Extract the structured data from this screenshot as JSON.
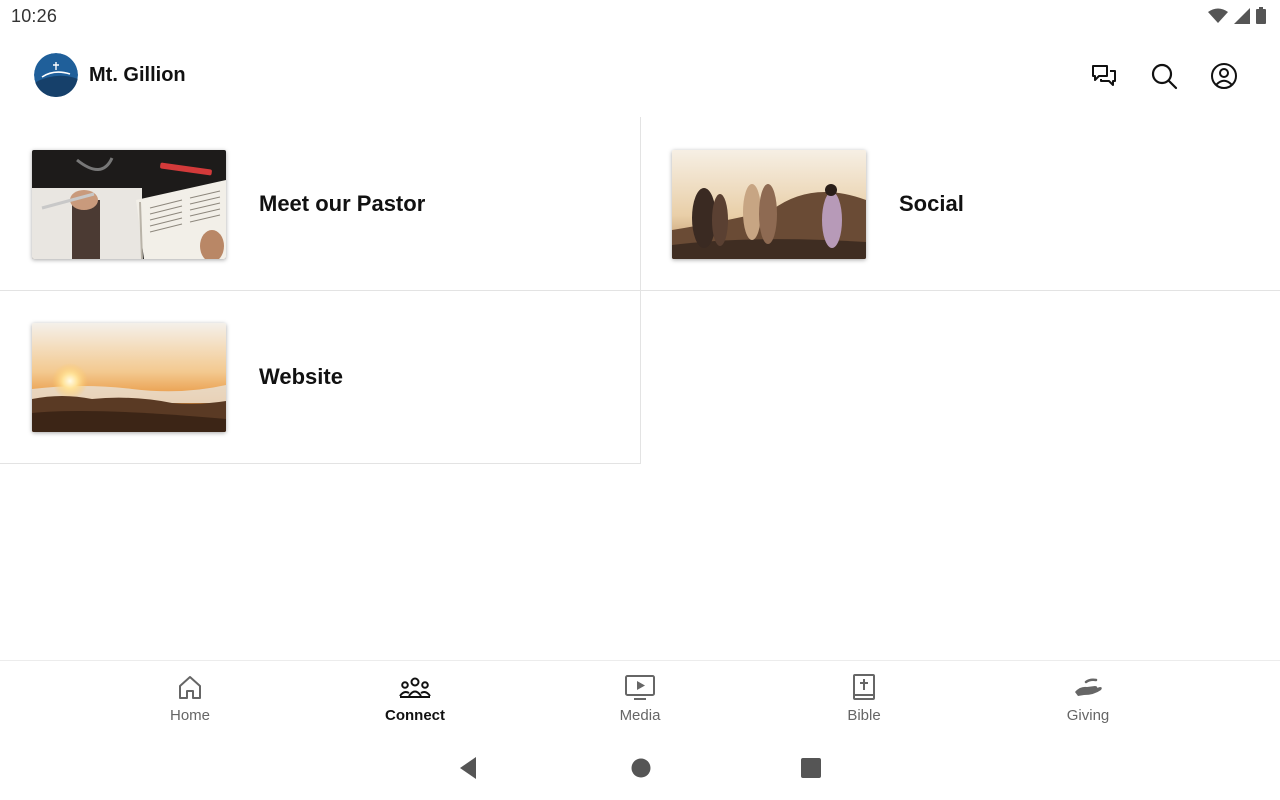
{
  "status_bar": {
    "time": "10:26"
  },
  "app": {
    "title": "Mt. Gillion"
  },
  "cards": [
    {
      "label": "Meet our Pastor"
    },
    {
      "label": "Social"
    },
    {
      "label": "Website"
    }
  ],
  "bottom_nav": [
    {
      "label": "Home",
      "icon": "home-icon"
    },
    {
      "label": "Connect",
      "icon": "people-icon",
      "active": true
    },
    {
      "label": "Media",
      "icon": "media-icon"
    },
    {
      "label": "Bible",
      "icon": "bible-icon"
    },
    {
      "label": "Giving",
      "icon": "giving-icon"
    }
  ],
  "colors": {
    "accent": "#111111",
    "inactive": "#666666",
    "divider": "#e3e3e3",
    "logo_blue": "#1f5f9a"
  }
}
